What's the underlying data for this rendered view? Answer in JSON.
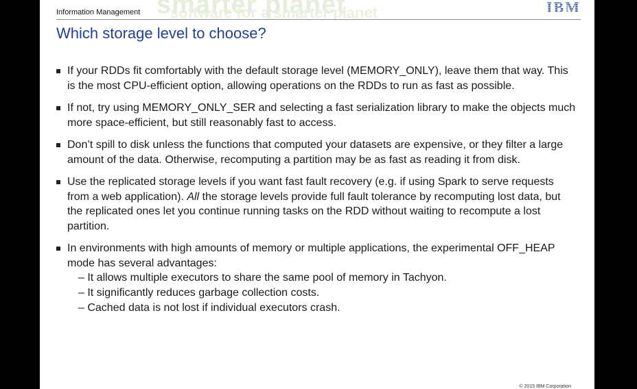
{
  "header": {
    "section_label": "Information Management",
    "logo_text": "IBM",
    "background_wordmark": "smarter planet",
    "background_tagline": "software for a smarter planet"
  },
  "slide": {
    "title": "Which storage level to choose?",
    "bullets": [
      {
        "text": "If your RDDs fit comfortably with the default storage level (MEMORY_ONLY), leave them that way. This is the most CPU-efficient option, allowing operations on the RDDs to run as fast as possible."
      },
      {
        "text": "If not, try using MEMORY_ONLY_SER and selecting a fast serialization library to make the objects much more space-efficient, but still reasonably fast to access."
      },
      {
        "text": "Don’t spill to disk unless the functions that computed your datasets are expensive, or they filter a large amount of the data. Otherwise, recomputing a partition may be as fast as reading it from disk."
      },
      {
        "text_before": "Use the replicated storage levels if you want fast fault recovery (e.g. if using Spark to serve requests from a web application). ",
        "emphasis": "All",
        "text_after": " the storage levels provide full fault tolerance by recomputing lost data, but the replicated ones let you continue running tasks on the RDD without waiting to recompute a lost partition."
      },
      {
        "text": "In environments with high amounts of memory or multiple applications, the experimental OFF_HEAP mode has several advantages:",
        "sub_items": [
          "– It allows multiple executors to share the same pool of memory in Tachyon.",
          "– It significantly reduces garbage collection costs.",
          "– Cached data is not lost if individual executors crash."
        ]
      }
    ]
  },
  "footer": {
    "copyright": "© 2015 IBM Corporation"
  }
}
